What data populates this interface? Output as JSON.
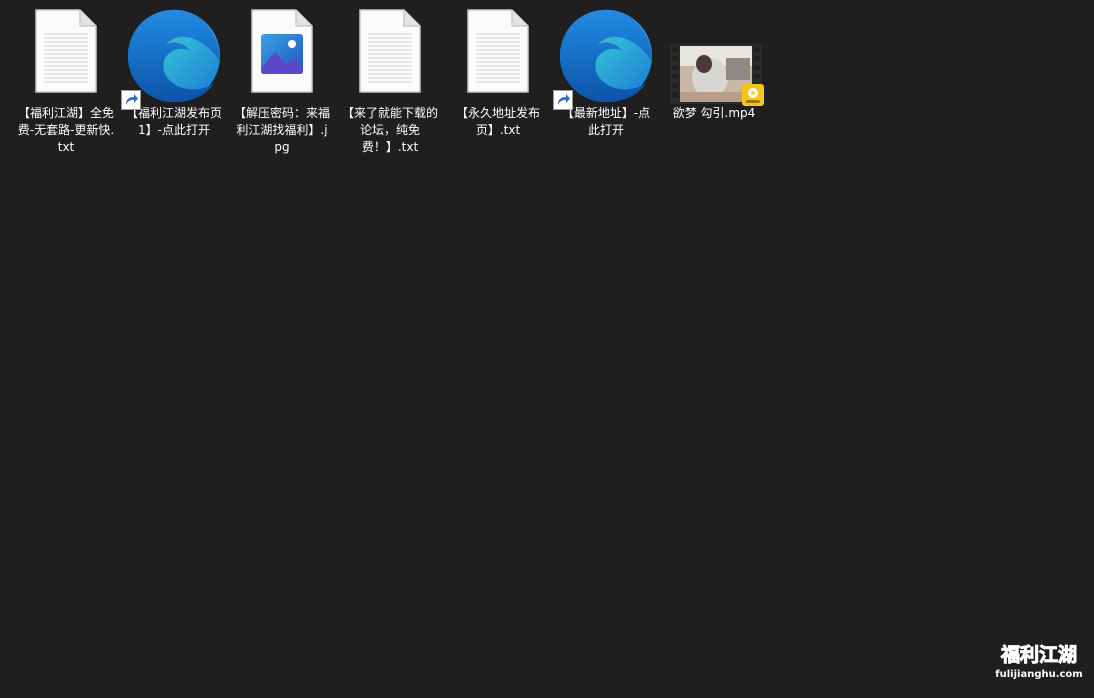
{
  "desktop": {
    "items": [
      {
        "label": "【福利江湖】全免费-无套路-更新快.txt",
        "icon": "text-file-icon",
        "shortcut": false
      },
      {
        "label": "【福利江湖发布页1】-点此打开",
        "icon": "edge-icon",
        "shortcut": true
      },
      {
        "label": "【解压密码：来福利江湖找福利】.jpg",
        "icon": "image-file-icon",
        "shortcut": false
      },
      {
        "label": "【来了就能下载的论坛，纯免费！】.txt",
        "icon": "text-file-icon",
        "shortcut": false
      },
      {
        "label": "【永久地址发布页】.txt",
        "icon": "text-file-icon",
        "shortcut": false
      },
      {
        "label": "【最新地址】-点此打开",
        "icon": "edge-icon",
        "shortcut": true
      },
      {
        "label": "欲梦 勾引.mp4",
        "icon": "video-file-icon",
        "shortcut": false
      }
    ]
  },
  "watermark": {
    "title_parts": [
      "福",
      "利",
      "江",
      "湖"
    ],
    "url": "fulijianghu.com"
  },
  "colors": {
    "background": "#1f1f1f",
    "label_text": "#ffffff",
    "edge_blue": "#1b74d4",
    "edge_green": "#4fc95a",
    "shortcut_blue": "#2d6fd6"
  }
}
